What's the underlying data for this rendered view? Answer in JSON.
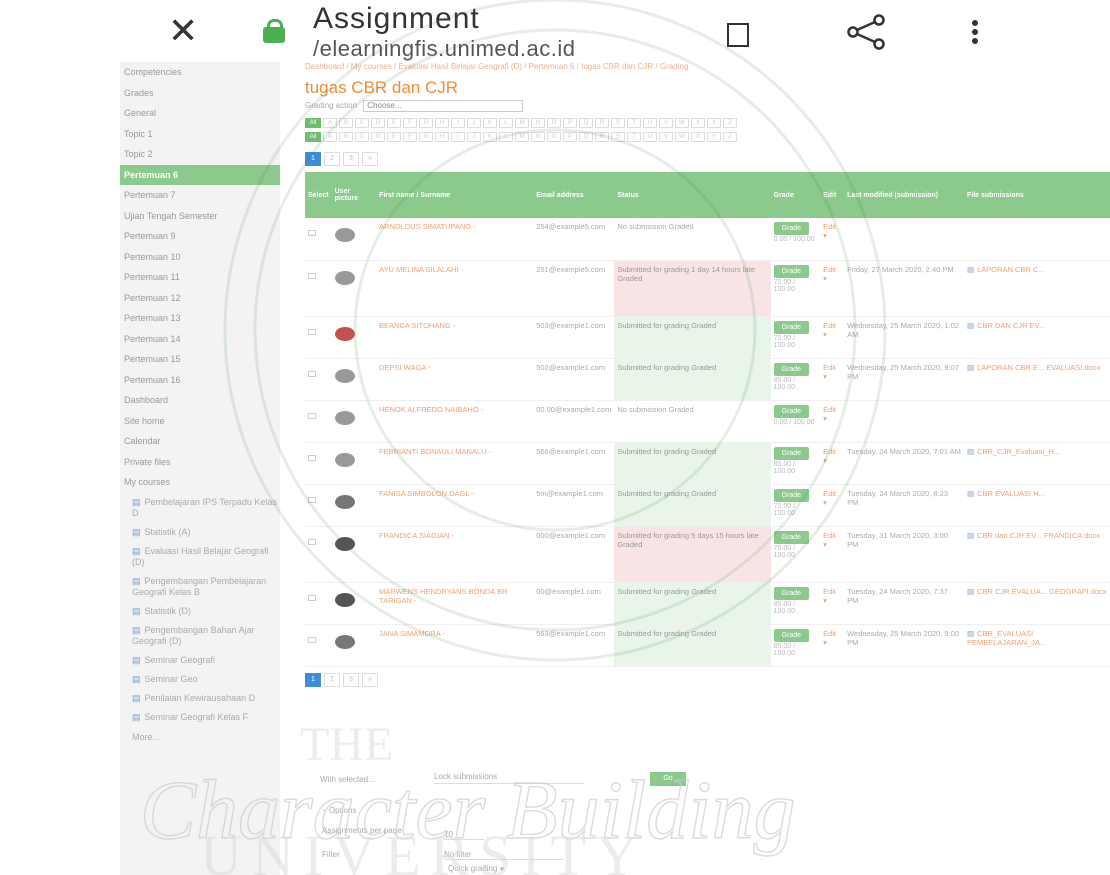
{
  "appbar": {
    "title": "Assignment",
    "url": "/elearningfis.unimed.ac.id"
  },
  "sidebar": {
    "items": [
      {
        "label": "Competencies",
        "active": false
      },
      {
        "label": "Grades",
        "active": false
      },
      {
        "label": "General",
        "active": false
      },
      {
        "label": "Topic 1",
        "active": false
      },
      {
        "label": "Topic 2",
        "active": false
      },
      {
        "label": "Pertemuan 6",
        "active": true
      },
      {
        "label": "Pertemuan 7",
        "active": false
      },
      {
        "label": "Ujian Tengah Semester",
        "active": false
      },
      {
        "label": "Pertemuan 9",
        "active": false
      },
      {
        "label": "Pertemuan 10",
        "active": false
      },
      {
        "label": "Pertemuan 11",
        "active": false
      },
      {
        "label": "Pertemuan 12",
        "active": false
      },
      {
        "label": "Pertemuan 13",
        "active": false
      },
      {
        "label": "Pertemuan 14",
        "active": false
      },
      {
        "label": "Pertemuan 15",
        "active": false
      },
      {
        "label": "Pertemuan 16",
        "active": false
      },
      {
        "label": "Dashboard",
        "active": false
      },
      {
        "label": "Site home",
        "active": false
      },
      {
        "label": "Calendar",
        "active": false
      },
      {
        "label": "Private files",
        "active": false
      },
      {
        "label": "My courses",
        "active": false
      }
    ],
    "courses": [
      "Pembelajaran IPS Terpadu Kelas D",
      "Statistik (A)",
      "Evaluasi Hasil Belajar Geografi (D)",
      "Pengembangan Pembelajaran Geografi Kelas B",
      "Statistik (D)",
      "Pengembangan Bahan Ajar Geografi (D)",
      "Seminar Geografi",
      "Seminar Geo",
      "Penilaian Kewirausahaan D",
      "Seminar Geografi Kelas F"
    ],
    "more": "More..."
  },
  "main": {
    "breadcrumbs": "Dashboard / My courses / Evaluasi Hasil Belajar Geografi (D) / Pertemuan 6 / tugas CBR dan CJR / Grading",
    "heading": "tugas CBR dan CJR",
    "grading_action_label": "Grading action",
    "grading_action_value": "Choose...",
    "letter_filters": [
      "All",
      "A",
      "B",
      "C",
      "D",
      "E",
      "F",
      "G",
      "H",
      "I",
      "J",
      "K",
      "L",
      "M",
      "N",
      "O",
      "P",
      "Q",
      "R",
      "S",
      "T",
      "U",
      "V",
      "W",
      "X",
      "Y",
      "Z"
    ],
    "pages": [
      "1",
      "2",
      "3",
      "»"
    ],
    "columns": [
      "Select",
      "User picture",
      "First name / Surname",
      "Email address",
      "Status",
      "Grade",
      "Edit",
      "Last modified (submission)",
      "File submissions"
    ],
    "rows": [
      {
        "name": "ARNOLDUS SIMATUPANG -",
        "email": "254@example5.com",
        "status": "No submission Graded",
        "status_type": "plain",
        "grade": "0.00 / 100.00",
        "modified": "",
        "file": "",
        "avatar": "gray"
      },
      {
        "name": "AYU MELINA SILALAHI -",
        "email": "251@example5.com",
        "status": "Submitted for grading 1 day 14 hours late Graded",
        "status_type": "late",
        "grade": "70.00 / 100.00",
        "modified": "Friday, 27 March 2020, 2:40 PM",
        "file": "LAPORAN CBR C...",
        "avatar": "gray"
      },
      {
        "name": "BEANCA SITOHANG -",
        "email": "503@example1.com",
        "status": "Submitted for grading Graded",
        "status_type": "ok",
        "grade": "70.00 / 100.00",
        "modified": "Wednesday, 25 March 2020, 1:02 AM",
        "file": "CBR DAN CJR EV...",
        "avatar": "red"
      },
      {
        "name": "DEPSI WAGA -",
        "email": "502@example1.com",
        "status": "Submitted for grading Graded",
        "status_type": "ok",
        "grade": "85.00 / 100.00",
        "modified": "Wednesday, 25 March 2020, 9:07 PM",
        "file": "LAPORAN CBR E... EVALUASI.docx",
        "avatar": "gray"
      },
      {
        "name": "HENOK ALFREDO NAIBAHO -",
        "email": "00.00@example1.com",
        "status": "No submission Graded",
        "status_type": "plain",
        "grade": "0.00 / 100.00",
        "modified": "",
        "file": "",
        "avatar": "bird"
      },
      {
        "name": "FEBRIANTI BONAULI MANALU -",
        "email": "566@example1.com",
        "status": "Submitted for grading Graded",
        "status_type": "ok",
        "grade": "85.00 / 100.00",
        "modified": "Tuesday, 24 March 2020, 7:01 AM",
        "file": "CBR_CJR_Evaluasi_H...",
        "avatar": "gray"
      },
      {
        "name": "FANISA SIMBOLON DAGL -",
        "email": "5m@example1.com",
        "status": "Submitted for grading Graded",
        "status_type": "ok",
        "grade": "70.00 / 100.00",
        "modified": "Tuesday, 24 March 2020, 8:23 PM",
        "file": "CBR EVALUASI H...",
        "avatar": "dim"
      },
      {
        "name": "FRANDICA SIAGIAN -",
        "email": "000@example1.com",
        "status": "Submitted for grading 5 days 15 hours late Graded",
        "status_type": "late",
        "grade": "70.00 / 100.00",
        "modified": "Tuesday, 31 March 2020, 3:00 PM",
        "file": "CBR dan CJR EV... FRANDICA.docx",
        "avatar": "dark"
      },
      {
        "name": "MARWENS HENDRYANS BONDA BR TARIGAN -",
        "email": "00@example1.com",
        "status": "Submitted for grading Graded",
        "status_type": "ok",
        "grade": "85.00 / 100.00",
        "modified": "Tuesday, 24 March 2020, 7:37 PM",
        "file": "CBR CJR EVALUA... GEOGRAFI.docx",
        "avatar": "dark"
      },
      {
        "name": "JANA SIMAMORA -",
        "email": "563@example1.com",
        "status": "Submitted for grading Graded",
        "status_type": "ok",
        "grade": "85.00 / 100.00",
        "modified": "Wednesday, 25 March 2020, 9:00 PM",
        "file": "CBR_EVALUASI PEMBELAJARAN_JA...",
        "avatar": "dim"
      }
    ],
    "grade_button": "Grade",
    "edit_label": "Edit",
    "bulk_label": "With selected...",
    "bulk_value": "Lock submissions",
    "go_label": "Go",
    "options_heading": "Options",
    "per_page_label": "Assignments per page",
    "per_page_value": "10",
    "filter_label": "Filter",
    "filter_value": "No filter",
    "quick_grading": "Quick grading",
    "show_active": "Show only active enrolments",
    "download_folders": "Download submissions in folders"
  },
  "watermark": {
    "line1": "THE",
    "line2": "Character Building",
    "line3": "UNIVERSITY"
  },
  "colors": {
    "accent_green": "#8cc98c",
    "link_orange": "#f08c3c",
    "lock_green": "#4caf50"
  }
}
